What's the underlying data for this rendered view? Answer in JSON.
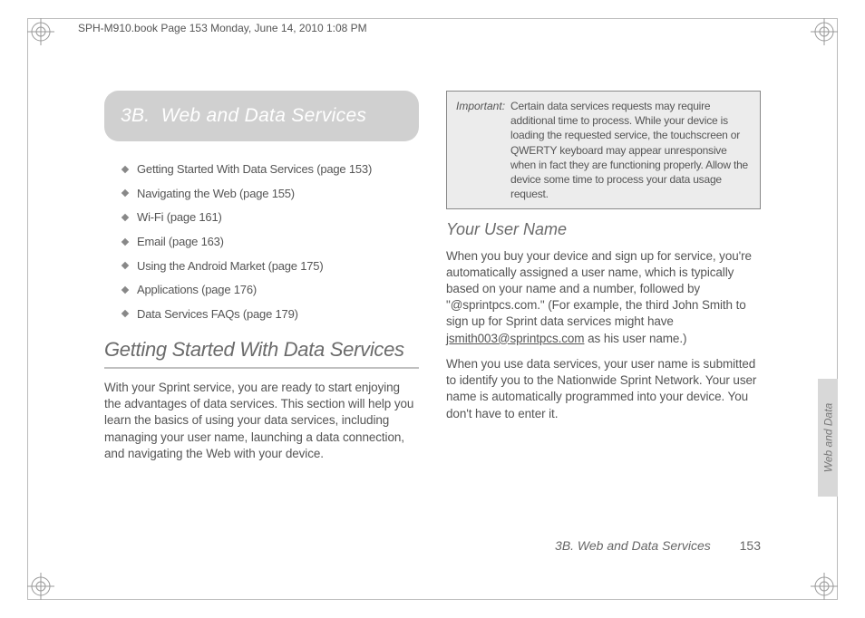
{
  "crop_header": "SPH-M910.book  Page 153  Monday, June 14, 2010  1:08 PM",
  "chapter": {
    "number": "3B.",
    "title": "Web and Data Services"
  },
  "toc": [
    "Getting Started With Data Services (page 153)",
    "Navigating the Web (page 155)",
    "Wi-Fi (page 161)",
    "Email (page 163)",
    "Using the Android Market (page 175)",
    "Applications (page 176)",
    "Data Services FAQs (page 179)"
  ],
  "section1": {
    "heading": "Getting Started With Data Services",
    "para": "With your Sprint service, you are ready to start enjoying the advantages of data services. This section will help you learn the basics of using your data services, including managing your user name, launching a data connection, and navigating the Web with your device."
  },
  "callout": {
    "label": "Important:",
    "body": "Certain data services requests may require additional time to process. While your device is loading the requested service, the touchscreen or QWERTY keyboard may appear unresponsive when in fact they are functioning properly. Allow the device some time to process your data usage request."
  },
  "section2": {
    "heading": "Your User Name",
    "para1_pre": "When you buy your device and sign up for service, you're automatically assigned a user name, which is typically based on your name and a number, followed by \"@sprintpcs.com.\" (For example, the third John Smith to sign up for Sprint data services might have ",
    "para1_link": "jsmith003@sprintpcs.com",
    "para1_post": " as his user name.)",
    "para2": "When you use data services, your user name is submitted to identify you to the Nationwide Sprint Network. Your user name is automatically programmed into your device. You don't have to enter it."
  },
  "side_tab": "Web and Data",
  "footer": {
    "section": "3B. Web and Data Services",
    "page": "153"
  }
}
